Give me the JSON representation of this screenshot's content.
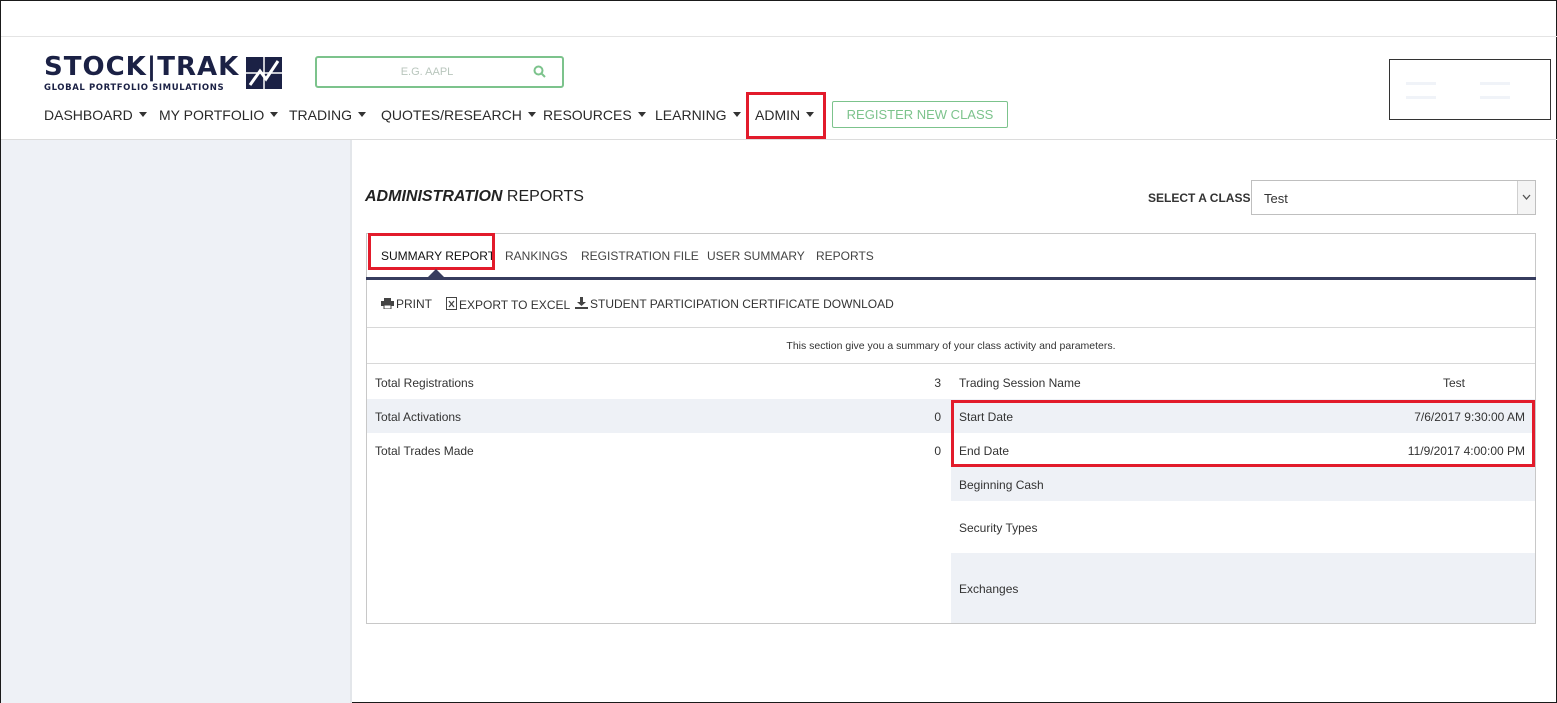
{
  "brand": {
    "name": "STOCK|TRAK",
    "tagline": "GLOBAL PORTFOLIO SIMULATIONS"
  },
  "search": {
    "placeholder": "E.G. AAPL",
    "value": ""
  },
  "nav": {
    "items": [
      {
        "label": "DASHBOARD"
      },
      {
        "label": "MY PORTFOLIO"
      },
      {
        "label": "TRADING"
      },
      {
        "label": "QUOTES/RESEARCH"
      },
      {
        "label": "RESOURCES"
      },
      {
        "label": "LEARNING"
      },
      {
        "label": "ADMIN"
      }
    ],
    "register_label": "REGISTER NEW CLASS"
  },
  "page": {
    "title_bold": "ADMINISTRATION",
    "title_rest": " REPORTS",
    "select_label": "SELECT A CLASS",
    "selected_class": "Test"
  },
  "tabs": [
    {
      "label": "SUMMARY REPORT",
      "active": true
    },
    {
      "label": "RANKINGS"
    },
    {
      "label": "REGISTRATION FILE"
    },
    {
      "label": "USER SUMMARY"
    },
    {
      "label": "REPORTS"
    }
  ],
  "actions": {
    "print": "PRINT",
    "export": "EXPORT TO EXCEL",
    "certificate": "STUDENT PARTICIPATION CERTIFICATE DOWNLOAD"
  },
  "summary": {
    "note": "This section give you a summary of your class activity and parameters.",
    "left": [
      {
        "label": "Total Registrations",
        "value": "3"
      },
      {
        "label": "Total Activations",
        "value": "0"
      },
      {
        "label": "Total Trades Made",
        "value": "0"
      }
    ],
    "right": [
      {
        "label": "Trading Session Name",
        "value": "Test"
      },
      {
        "label": "Start Date",
        "value": "7/6/2017 9:30:00 AM"
      },
      {
        "label": "End Date",
        "value": "11/9/2017 4:00:00 PM"
      },
      {
        "label": "Beginning Cash",
        "value": ""
      },
      {
        "label": "Security Types",
        "value": ""
      },
      {
        "label": "Exchanges",
        "value": ""
      }
    ]
  },
  "colors": {
    "brand_navy": "#1b2145",
    "accent_green": "#7cc38c",
    "highlight_red": "#e21b2b",
    "tab_rule": "#363c5e"
  }
}
